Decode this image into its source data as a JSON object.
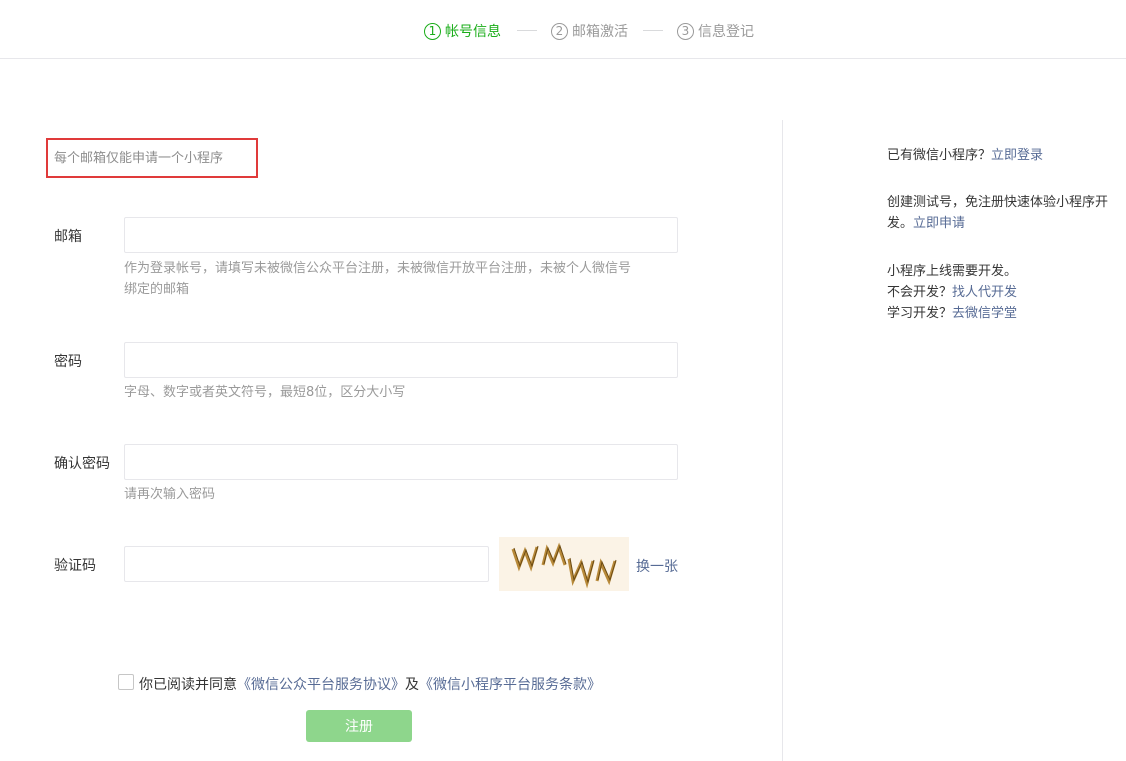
{
  "steps": [
    {
      "num": "1",
      "label": "帐号信息",
      "active": true
    },
    {
      "num": "2",
      "label": "邮箱激活",
      "active": false
    },
    {
      "num": "3",
      "label": "信息登记",
      "active": false
    }
  ],
  "notice": "每个邮箱仅能申请一个小程序",
  "form": {
    "email": {
      "label": "邮箱",
      "value": "",
      "hint_line1": "作为登录帐号，请填写未被微信公众平台注册，未被微信开放平台注册，未被个人微信号",
      "hint_line2": "绑定的邮箱"
    },
    "password": {
      "label": "密码",
      "value": "",
      "hint": "字母、数字或者英文符号，最短8位，区分大小写"
    },
    "confirm": {
      "label": "确认密码",
      "value": "",
      "hint": "请再次输入密码"
    },
    "captcha": {
      "label": "验证码",
      "value": "",
      "image_text": "WMMN",
      "change_label": "换一张"
    }
  },
  "agreement": {
    "checked": false,
    "prefix": "你已阅读并同意",
    "link1": "《微信公众平台服务协议》",
    "and": "及",
    "link2": "《微信小程序平台服务条款》"
  },
  "submit_label": "注册",
  "sidebar": {
    "login_prompt": "已有微信小程序？",
    "login_link": "立即登录",
    "test_line1": "创建测试号，免注册快速体验小程序开",
    "test_line2_prefix": "发。",
    "test_link": "立即申请",
    "dev_title": "小程序上线需要开发。",
    "dev_prompt": "不会开发？",
    "dev_link": "找人代开发",
    "learn_prompt": "学习开发？",
    "learn_link": "去微信学堂"
  },
  "colors": {
    "accent_green": "#1aad19",
    "link_blue": "#576b95",
    "highlight_red": "#e03a3a",
    "button_disabled_green": "#8ed68c"
  }
}
